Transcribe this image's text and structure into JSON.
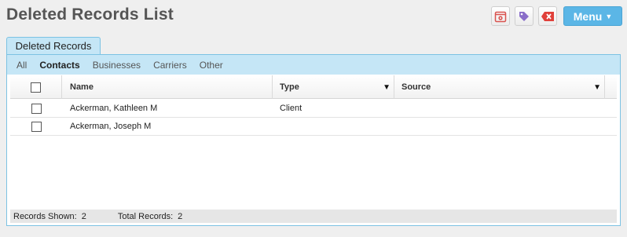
{
  "page": {
    "title": "Deleted Records List"
  },
  "toolbar": {
    "buttons": [
      {
        "icon": "calendar-settings-icon",
        "color": "#d9534f"
      },
      {
        "icon": "tag-icon",
        "color": "#8a6ec9"
      },
      {
        "icon": "delete-tag-icon",
        "color": "#e0403a"
      }
    ],
    "menu_label": "Menu",
    "menu_color": "#5bb6e6"
  },
  "tab": {
    "label": "Deleted Records"
  },
  "filters": [
    "All",
    "Contacts",
    "Businesses",
    "Carriers",
    "Other"
  ],
  "active_filter": "Contacts",
  "grid": {
    "columns": {
      "name": "Name",
      "type": "Type",
      "source": "Source"
    },
    "rows": [
      {
        "name": "Ackerman, Kathleen M",
        "type": "Client",
        "source": ""
      },
      {
        "name": "Ackerman, Joseph M",
        "type": "",
        "source": ""
      }
    ]
  },
  "footer": {
    "shown_label": "Records Shown:",
    "shown_value": "2",
    "total_label": "Total Records:",
    "total_value": "2"
  },
  "colors": {
    "tab_bg": "#c5e6f6",
    "tab_border": "#7cc2e3",
    "background": "#efefef"
  }
}
